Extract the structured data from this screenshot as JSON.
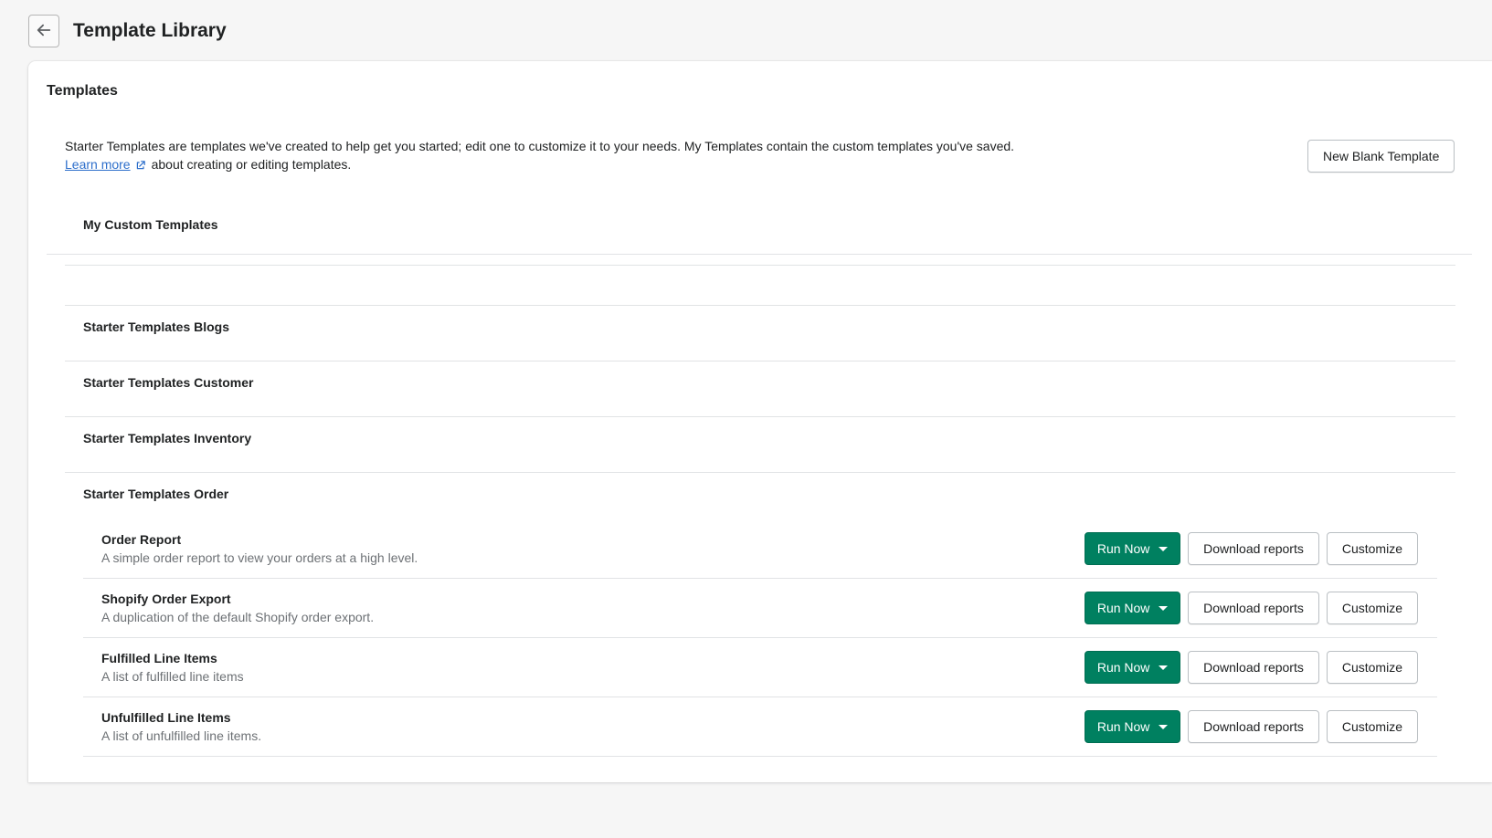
{
  "header": {
    "title": "Template Library",
    "back_icon": "arrow-left-icon"
  },
  "card": {
    "title": "Templates",
    "intro": {
      "line1": "Starter Templates are templates we've created to help get you started; edit one to customize it to your needs. My Templates contain the custom templates you've saved.",
      "learn_more": "Learn more",
      "line2_suffix": "about creating or editing templates.",
      "new_template_button": "New Blank Template"
    }
  },
  "sections": {
    "custom": "My Custom Templates",
    "blogs": "Starter Templates Blogs",
    "customer": "Starter Templates Customer",
    "inventory": "Starter Templates Inventory",
    "order": "Starter Templates Order"
  },
  "actions": {
    "run_now": "Run Now",
    "download": "Download reports",
    "customize": "Customize"
  },
  "order_templates": [
    {
      "name": "Order Report",
      "description": "A simple order report to view your orders at a high level."
    },
    {
      "name": "Shopify Order Export",
      "description": "A duplication of the default Shopify order export."
    },
    {
      "name": "Fulfilled Line Items",
      "description": "A list of fulfilled line items"
    },
    {
      "name": "Unfulfilled Line Items",
      "description": "A list of unfulfilled line items."
    }
  ],
  "colors": {
    "primary_button": "#008060",
    "link": "#2c6ecb",
    "page_background": "#f6f6f6"
  }
}
